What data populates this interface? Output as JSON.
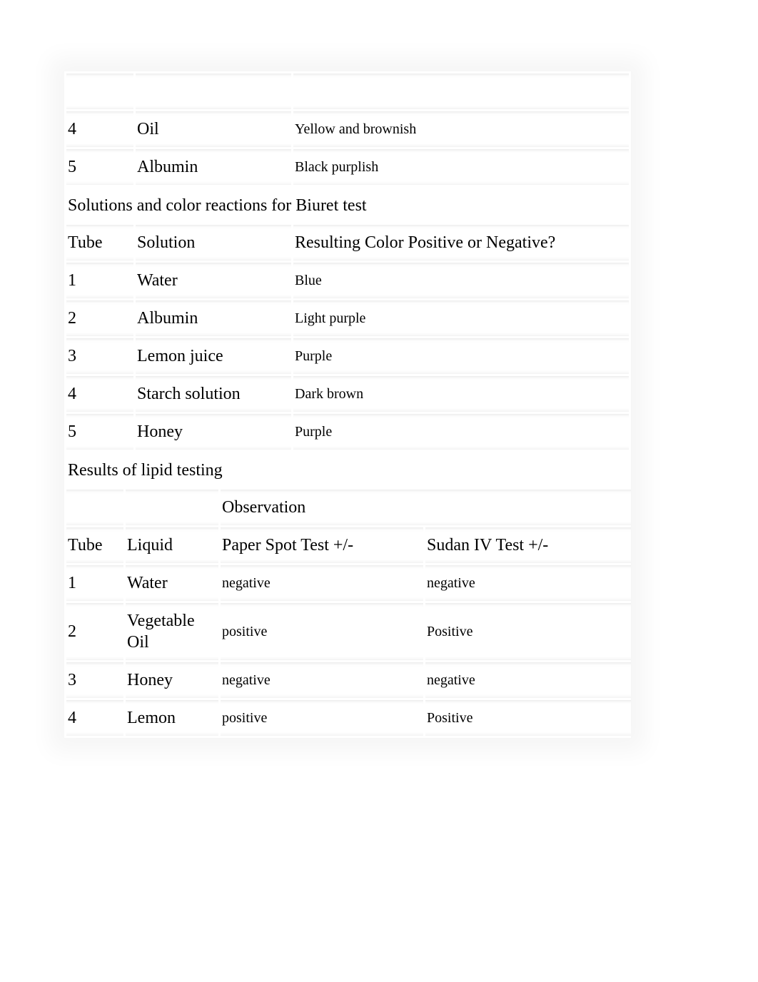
{
  "partial_table": {
    "rows": [
      {
        "tube": "4",
        "solution": "Oil",
        "result": "Yellow and brownish"
      },
      {
        "tube": "5",
        "solution": "Albumin",
        "result": "Black purplish"
      }
    ]
  },
  "biuret": {
    "title": "Solutions and color reactions for Biuret test",
    "headers": {
      "tube": "Tube",
      "solution": "Solution",
      "result": "Resulting Color Positive or Negative?"
    },
    "rows": [
      {
        "tube": "1",
        "solution": "Water",
        "result": "Blue"
      },
      {
        "tube": "2",
        "solution": "Albumin",
        "result": "Light purple"
      },
      {
        "tube": "3",
        "solution": "Lemon juice",
        "result": "Purple"
      },
      {
        "tube": "4",
        "solution": "Starch solution",
        "result": "Dark brown"
      },
      {
        "tube": "5",
        "solution": "Honey",
        "result": "Purple"
      }
    ]
  },
  "lipid": {
    "title": "Results of lipid testing",
    "observation_label": "Observation",
    "headers": {
      "tube": "Tube",
      "liquid": "Liquid",
      "paper": "Paper Spot Test +/-",
      "sudan": "Sudan IV Test +/-"
    },
    "rows": [
      {
        "tube": "1",
        "liquid": "Water",
        "paper": "negative",
        "sudan": "negative"
      },
      {
        "tube": "2",
        "liquid": "Vegetable Oil",
        "paper": "positive",
        "sudan": "Positive"
      },
      {
        "tube": "3",
        "liquid": "Honey",
        "paper": "negative",
        "sudan": "negative"
      },
      {
        "tube": "4",
        "liquid": "Lemon",
        "paper": "positive",
        "sudan": "Positive"
      }
    ]
  }
}
